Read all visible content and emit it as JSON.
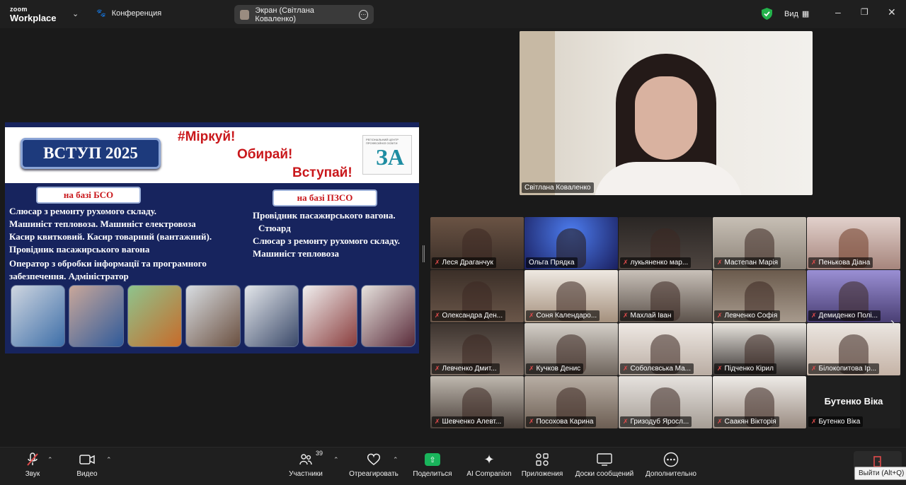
{
  "titlebar": {
    "logo_top": "zoom",
    "logo_bottom": "Workplace",
    "meeting_label": "Конференция",
    "screen_share_label": "Экран (Світлана Коваленко)",
    "view_label": "Вид"
  },
  "slide": {
    "title": "ВСТУП 2025",
    "slogan1": "#Міркуй!",
    "slogan2": "Обирай!",
    "slogan3": "Вступай!",
    "logo_letters": "ЗА",
    "logo_caption": "РЕГІОНАЛЬНИЙ ЦЕНТР ПРОФЕСІЙНОЇ ОСВІТИ",
    "left_tag": "на базі БСО",
    "right_tag": "на базі ПЗСО",
    "left_lines": [
      "Слюсар з ремонту рухомого складу.",
      "Машиніст тепловоза. Машиніст електровоза",
      "Касир квитковий. Касир товарний (вантажний).",
      "Провідник пасажирського вагона",
      "Оператор з обробки інформації  та програмного",
      "забезпечення. Адміністратор"
    ],
    "right_lines": [
      "Провідник пасажирського вагона.",
      "Стюард",
      "Слюсар з ремонту рухомого складу.",
      "Машиніст тепловоза"
    ]
  },
  "speaker": {
    "name": "Світлана Коваленко"
  },
  "participants": [
    {
      "name": "Леся Драганчук",
      "muted": true
    },
    {
      "name": "Ольга Прядка",
      "muted": false
    },
    {
      "name": "лукьяненко мар...",
      "muted": true
    },
    {
      "name": "Мастепан Марія",
      "muted": true
    },
    {
      "name": "Пенькова Діана",
      "muted": true
    },
    {
      "name": "Олександра Ден...",
      "muted": true
    },
    {
      "name": "Соня Календаро...",
      "muted": true
    },
    {
      "name": "Махлай Іван",
      "muted": true
    },
    {
      "name": "Левченко Софія",
      "muted": true
    },
    {
      "name": "Демиденко Полі...",
      "muted": true
    },
    {
      "name": "Левченко Дмит...",
      "muted": true
    },
    {
      "name": "Кучков Денис",
      "muted": true
    },
    {
      "name": "Соболєвська Ма...",
      "muted": true
    },
    {
      "name": "Підченко Кірил",
      "muted": true
    },
    {
      "name": "Білокопитова Ір...",
      "muted": true
    },
    {
      "name": "Шевченко Алевт...",
      "muted": true
    },
    {
      "name": "Посохова Карина",
      "muted": true
    },
    {
      "name": "Гризодуб Яросл...",
      "muted": true
    },
    {
      "name": "Саакян Вікторія",
      "muted": true
    },
    {
      "name": "Бутенко Віка",
      "muted": true
    }
  ],
  "no_video_name": "Бутенко Віка",
  "toolbar": {
    "audio": "Звук",
    "video": "Видео",
    "participants": "Участники",
    "participants_count": "39",
    "react": "Отреагировать",
    "share": "Поделиться",
    "ai": "AI Companion",
    "apps": "Приложения",
    "whiteboards": "Доски сообщений",
    "more": "Дополнительно",
    "exit_tooltip": "Выйти (Alt+Q)"
  },
  "colors": {
    "share_green": "#19b45b",
    "slide_navy": "#17245e",
    "slogan_red": "#c9171b",
    "mute_red": "#e04b4b"
  }
}
